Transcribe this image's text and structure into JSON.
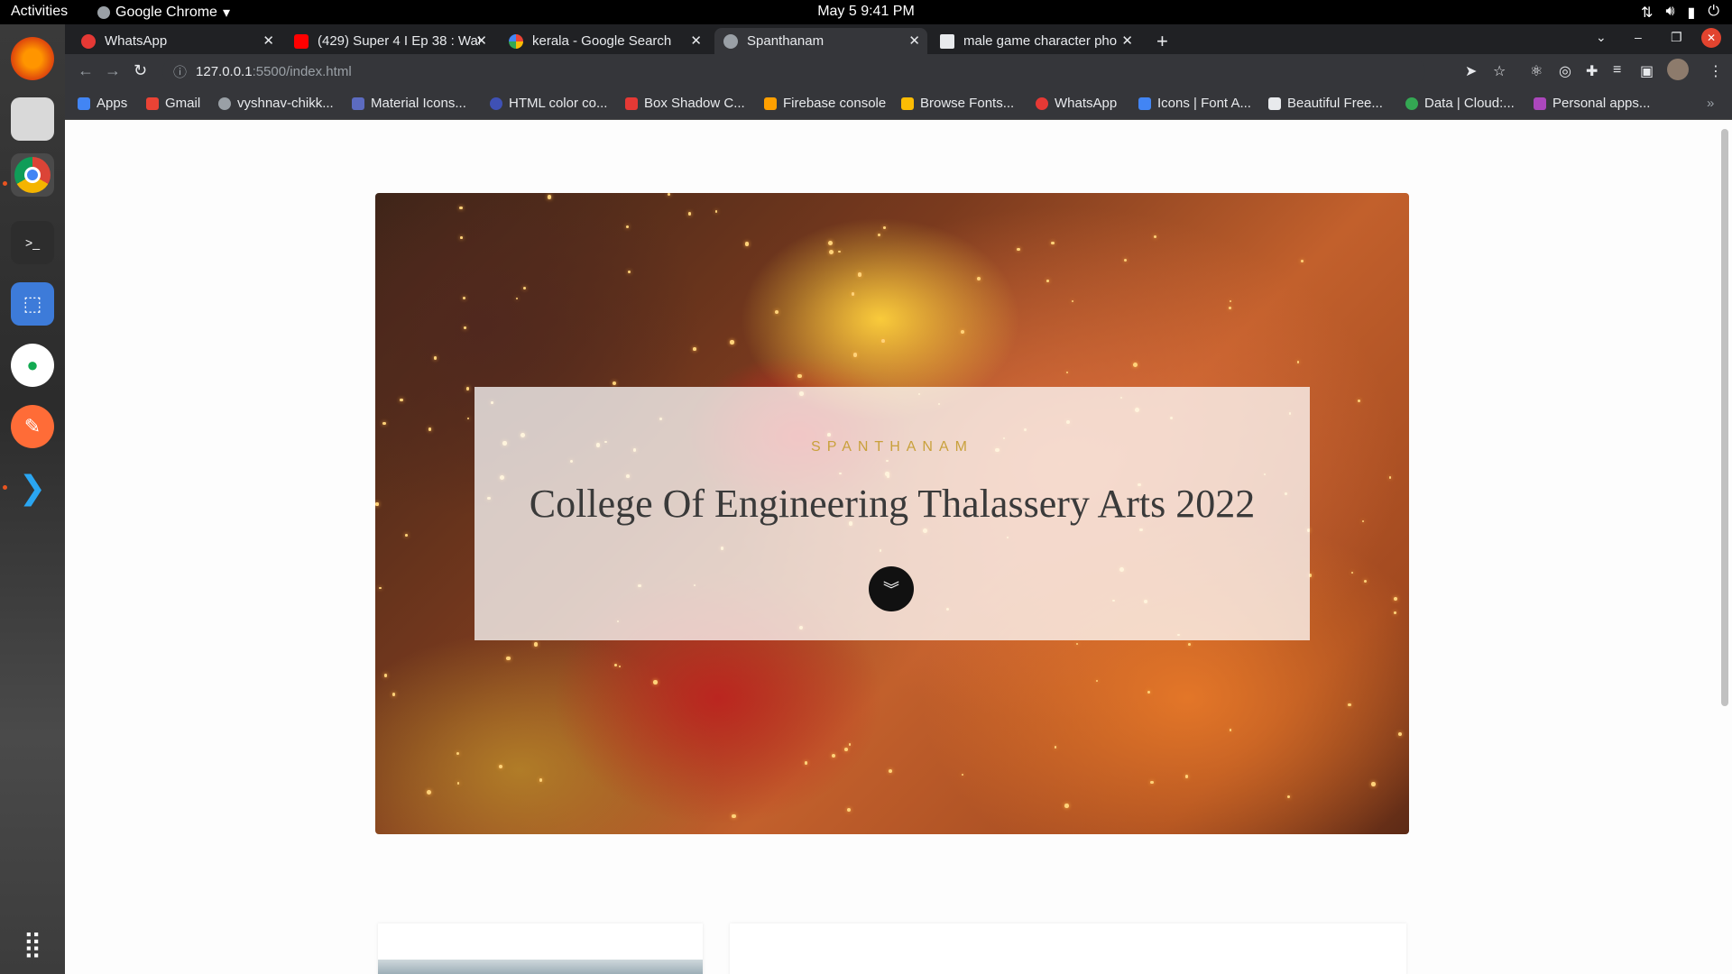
{
  "system_bar": {
    "activities": "Activities",
    "app_name": "Google Chrome",
    "clock": "May 5  9:41 PM"
  },
  "tabs": [
    {
      "title": "WhatsApp",
      "favicon_color": "#e53935"
    },
    {
      "title": "(429) Super 4 I Ep 38 : Wat",
      "favicon_color": "#ff0000"
    },
    {
      "title": "kerala - Google Search",
      "favicon_color": "#4285f4"
    },
    {
      "title": "Spanthanam",
      "favicon_color": "#9aa0a6"
    },
    {
      "title": "male game character pho",
      "favicon_color": "#e8eaed"
    }
  ],
  "address_bar": {
    "host": "127.0.0.1",
    "path": ":5500/index.html"
  },
  "bookmarks": [
    {
      "label": "Apps",
      "color": "#4285f4"
    },
    {
      "label": "Gmail",
      "color": "#ea4335"
    },
    {
      "label": "vyshnav-chikk...",
      "color": "#9aa0a6"
    },
    {
      "label": "Material Icons...",
      "color": "#5c6bc0"
    },
    {
      "label": "HTML color co...",
      "color": "#3f51b5"
    },
    {
      "label": "Box Shadow C...",
      "color": "#e53935"
    },
    {
      "label": "Firebase console",
      "color": "#ffa000"
    },
    {
      "label": "Browse Fonts...",
      "color": "#fbbc04"
    },
    {
      "label": "WhatsApp",
      "color": "#e53935"
    },
    {
      "label": "Icons | Font A...",
      "color": "#4285f4"
    },
    {
      "label": "Beautiful Free...",
      "color": "#e8eaed"
    },
    {
      "label": "Data | Cloud:...",
      "color": "#34a853"
    },
    {
      "label": "Personal apps...",
      "color": "#ab47bc"
    }
  ],
  "hero": {
    "eyebrow": "SPANTHANAM",
    "title": "College Of Engineering Thalassery Arts 2022",
    "scroll_icon": "chevron-double-down-icon",
    "accent_color": "#c9a13c"
  }
}
